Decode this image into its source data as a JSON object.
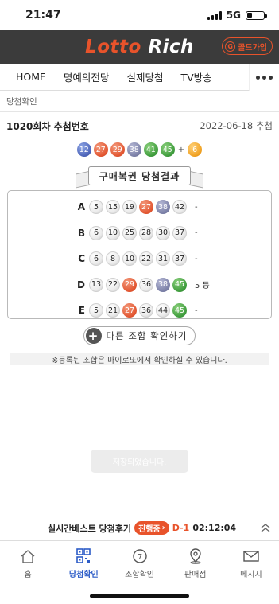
{
  "status": {
    "time": "21:47",
    "network": "5G"
  },
  "brand": {
    "logo_part1": "Lotto",
    "logo_part2": "Rich",
    "gold_icon": "G",
    "gold_label": "골드가입"
  },
  "nav": {
    "tabs": [
      "HOME",
      "명예의전당",
      "실제당첨",
      "TV방송"
    ]
  },
  "breadcrumb": "당첨확인",
  "draw": {
    "title": "1020회차 추첨번호",
    "date": "2022-06-18 추첨",
    "numbers": [
      {
        "n": "12",
        "c": "blue"
      },
      {
        "n": "27",
        "c": "red"
      },
      {
        "n": "29",
        "c": "red"
      },
      {
        "n": "38",
        "c": "gray"
      },
      {
        "n": "41",
        "c": "green"
      },
      {
        "n": "45",
        "c": "green"
      }
    ],
    "plus": "+",
    "bonus": {
      "n": "6",
      "c": "yellow"
    }
  },
  "results_title": "구매복권 당첨결과",
  "results": [
    {
      "label": "A",
      "balls": [
        {
          "n": "5",
          "c": "white"
        },
        {
          "n": "15",
          "c": "white"
        },
        {
          "n": "19",
          "c": "white"
        },
        {
          "n": "27",
          "c": "red"
        },
        {
          "n": "38",
          "c": "gray"
        },
        {
          "n": "42",
          "c": "white"
        }
      ],
      "result": "-"
    },
    {
      "label": "B",
      "balls": [
        {
          "n": "6",
          "c": "white"
        },
        {
          "n": "10",
          "c": "white"
        },
        {
          "n": "25",
          "c": "white"
        },
        {
          "n": "28",
          "c": "white"
        },
        {
          "n": "30",
          "c": "white"
        },
        {
          "n": "37",
          "c": "white"
        }
      ],
      "result": "-"
    },
    {
      "label": "C",
      "balls": [
        {
          "n": "6",
          "c": "white"
        },
        {
          "n": "8",
          "c": "white"
        },
        {
          "n": "10",
          "c": "white"
        },
        {
          "n": "22",
          "c": "white"
        },
        {
          "n": "31",
          "c": "white"
        },
        {
          "n": "37",
          "c": "white"
        }
      ],
      "result": "-"
    },
    {
      "label": "D",
      "balls": [
        {
          "n": "13",
          "c": "white"
        },
        {
          "n": "22",
          "c": "white"
        },
        {
          "n": "29",
          "c": "red"
        },
        {
          "n": "36",
          "c": "white"
        },
        {
          "n": "38",
          "c": "gray"
        },
        {
          "n": "45",
          "c": "green"
        }
      ],
      "result": "5 등"
    },
    {
      "label": "E",
      "balls": [
        {
          "n": "5",
          "c": "white"
        },
        {
          "n": "21",
          "c": "white"
        },
        {
          "n": "27",
          "c": "red"
        },
        {
          "n": "36",
          "c": "white"
        },
        {
          "n": "44",
          "c": "white"
        },
        {
          "n": "45",
          "c": "green"
        }
      ],
      "result": "-"
    }
  ],
  "add_button": "다른 조합 확인하기",
  "notice": "※등록된 조합은 마이로또에서 확인하실 수 있습니다.",
  "toast": "저장되었습니다.",
  "live": {
    "title": "실시간베스트 당첨후기",
    "status": "진행중",
    "dday": "D-1",
    "time": "02:12:04"
  },
  "bottom_nav": [
    "홈",
    "당첨확인",
    "조합확인",
    "판매점",
    "메시지"
  ],
  "colors": {
    "accent": "#e8532b",
    "active": "#2c5cc7",
    "brandbar": "#3b3b3b"
  }
}
